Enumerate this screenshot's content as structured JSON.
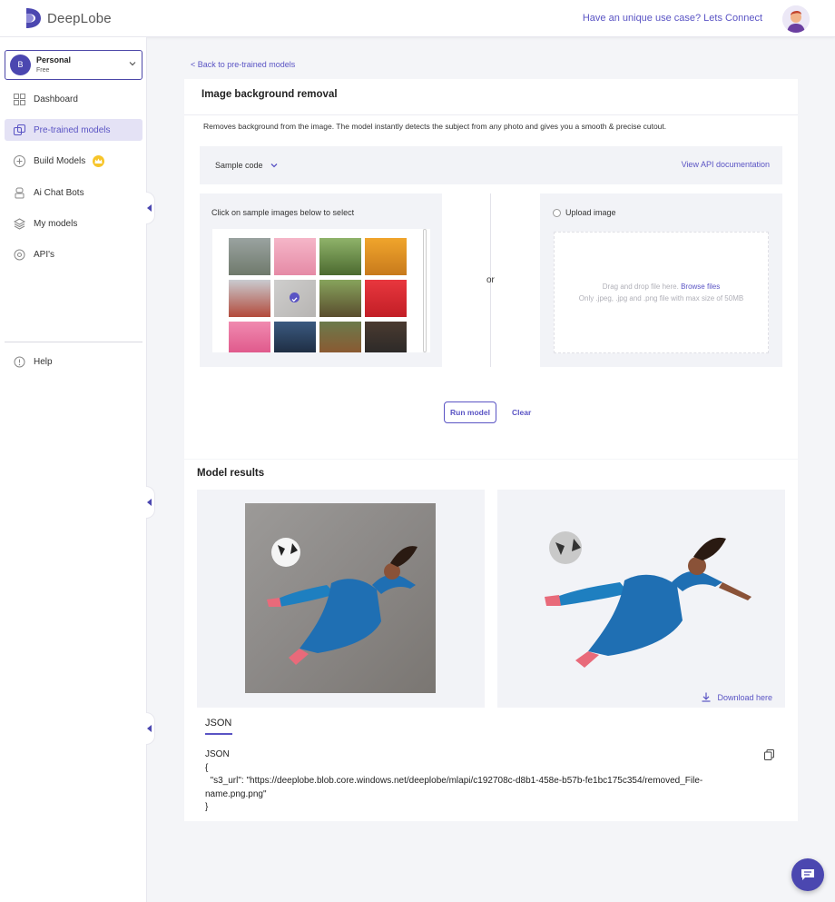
{
  "app": {
    "brand": "DeepLobe"
  },
  "header": {
    "connect_text": "Have an unique use case? Lets Connect",
    "avatar_icon": "user-avatar-icon"
  },
  "sidebar": {
    "account": {
      "initial": "B",
      "name": "Personal",
      "plan": "Free"
    },
    "items": [
      {
        "label": "Dashboard",
        "icon": "grid-icon"
      },
      {
        "label": "Pre-trained models",
        "icon": "models-icon",
        "active": true
      },
      {
        "label": "Build Models",
        "icon": "plus-circle-icon",
        "badge": "crown-icon"
      },
      {
        "label": "Ai Chat Bots",
        "icon": "bot-icon"
      },
      {
        "label": "My models",
        "icon": "layers-icon"
      },
      {
        "label": "API's",
        "icon": "api-icon"
      }
    ],
    "help": {
      "label": "Help",
      "icon": "info-icon"
    }
  },
  "page": {
    "back_link": "< Back to pre-trained models",
    "title": "Image background removal",
    "description": "Removes background from the image. The model instantly detects the subject from any photo and gives you a smooth & precise cutout.",
    "sample_code_label": "Sample code",
    "api_doc_link": "View API documentation",
    "samples_hint": "Click on sample images below to select",
    "or_label": "or",
    "upload_label": "Upload image",
    "drop_text": "Drag and drop file here.",
    "browse_link": "Browse files",
    "file_hint": "Only .jpeg, .jpg and .png file with max size of 50MB",
    "run_button": "Run model",
    "clear_button": "Clear"
  },
  "results": {
    "title": "Model results",
    "download_label": "Download here",
    "json_tab": "JSON",
    "json_text": "JSON\n{\n  \"s3_url\": \"https://deeplobe.blob.core.windows.net/deeplobe/mlapi/c192708c-d8b1-458e-b57b-fe1bc175c354/removed_File-\nname.png.png\"\n}"
  },
  "colors": {
    "accent": "#5a54c4",
    "accent_dark": "#4b47b0",
    "crown": "#f7c52a"
  }
}
